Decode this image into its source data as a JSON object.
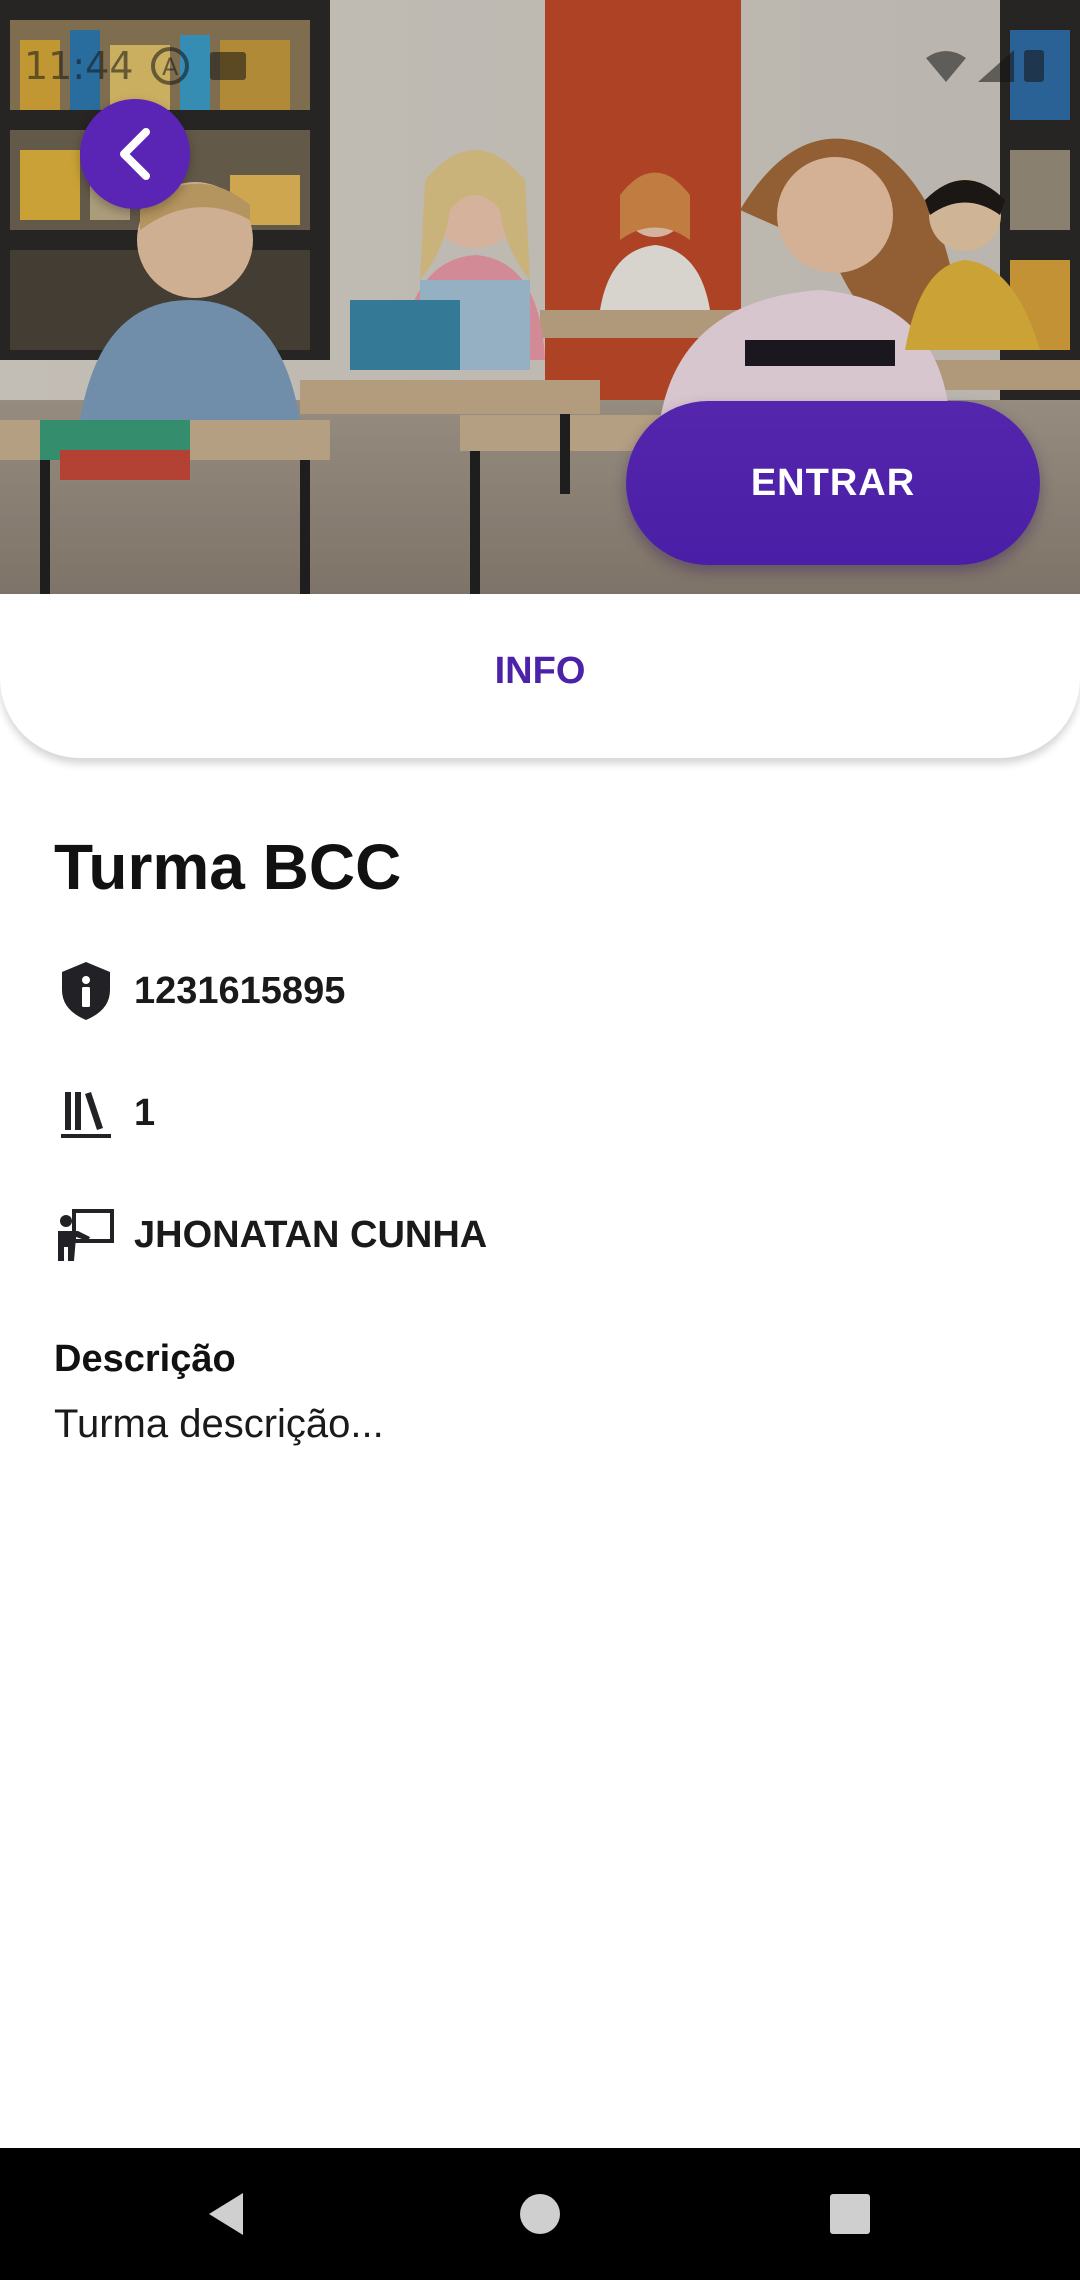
{
  "status_bar": {
    "time": "11:44"
  },
  "header": {
    "back_icon": "chevron-left-icon",
    "enter_label": "ENTRAR"
  },
  "tabs": {
    "info_label": "INFO"
  },
  "class_info": {
    "title": "Turma BCC",
    "code": "1231615895",
    "books_count": "1",
    "teacher": "JHONATAN CUNHA",
    "description_label": "Descrição",
    "description": "Turma descrição..."
  },
  "colors": {
    "accent": "#4b22a8",
    "button": "#5426ad",
    "text": "#111111",
    "navbar": "#000000"
  },
  "icons": {
    "code": "shield-info-icon",
    "books": "books-icon",
    "teacher": "teacher-icon"
  }
}
